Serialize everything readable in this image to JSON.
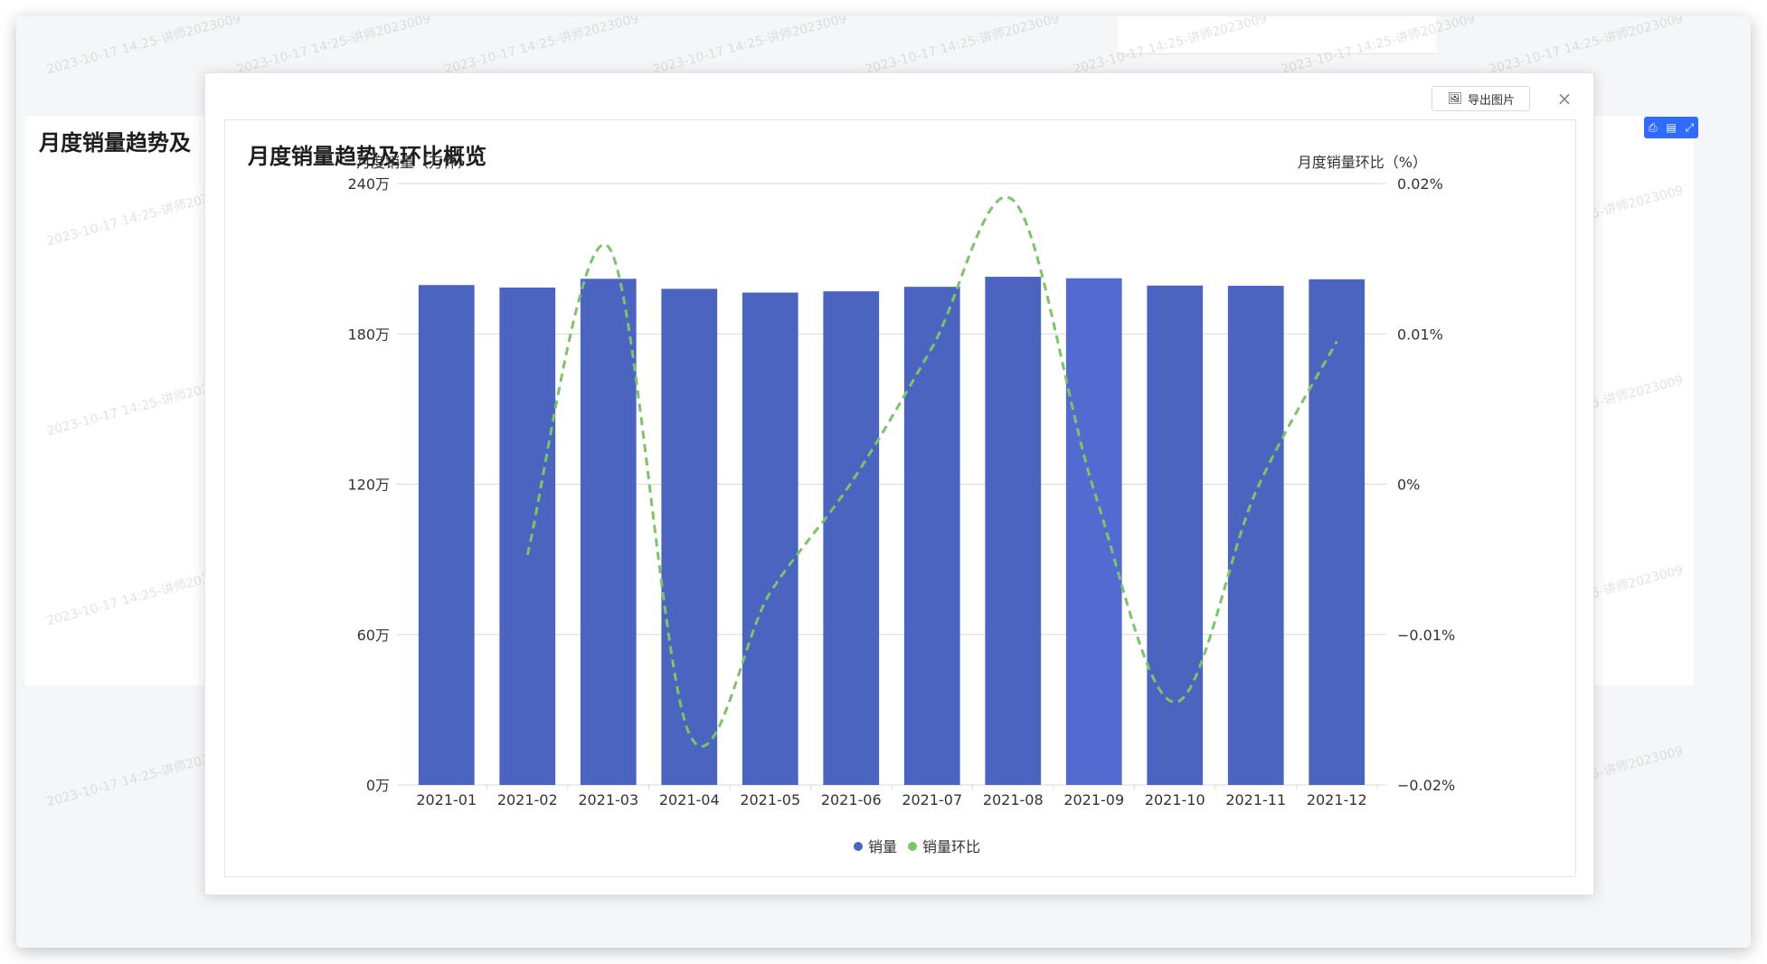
{
  "background": {
    "title": "月度销量趋势及"
  },
  "modal": {
    "export_label": "导出图片",
    "close_label": "×"
  },
  "watermark_text": "2023-10-17 14:25-讲师2023009",
  "colors": {
    "bar": "#4a64bf",
    "bar_highlight": "#536bd1",
    "line": "#7cc46a",
    "grid": "#d9d9d9",
    "axis_text": "#333333"
  },
  "chart_data": {
    "type": "bar",
    "title": "月度销量趋势及环比概览",
    "categories": [
      "2021-01",
      "2021-02",
      "2021-03",
      "2021-04",
      "2021-05",
      "2021-06",
      "2021-07",
      "2021-08",
      "2021-09",
      "2021-10",
      "2021-11",
      "2021-12"
    ],
    "y_left_label": "月度销量（万件）",
    "y_right_label": "月度销量环比（%）",
    "y_left_ticks": [
      "0万",
      "60万",
      "120万",
      "180万",
      "240万"
    ],
    "y_right_ticks": [
      "−0.02%",
      "−0.01%",
      "0%",
      "0.01%",
      "0.02%"
    ],
    "ylim_left": [
      0,
      240
    ],
    "ylim_right": [
      -0.02,
      0.02
    ],
    "highlight_index": 8,
    "series": [
      {
        "name": "销量",
        "type": "bar",
        "values": [
          199.5,
          198.5,
          202,
          198,
          196.5,
          197,
          198.8,
          202.8,
          202.2,
          199.3,
          199.2,
          201.8
        ]
      },
      {
        "name": "销量环比",
        "type": "line",
        "style": "dashed-smooth",
        "values": [
          null,
          -0.0047,
          0.0158,
          -0.0166,
          -0.0072,
          0.0001,
          0.0091,
          0.0189,
          -0.0004,
          -0.0145,
          -0.0005,
          0.0095
        ]
      }
    ],
    "grid": true,
    "legend": "bottom-center"
  }
}
